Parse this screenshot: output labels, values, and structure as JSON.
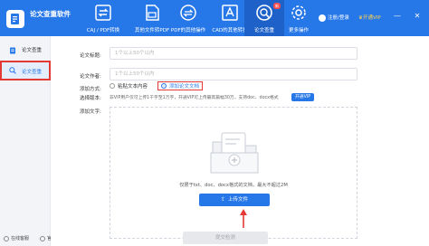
{
  "app": {
    "name": "论文查重软件"
  },
  "toolbar": {
    "items": [
      {
        "label": "CAJ / PDF转换",
        "icon": "convert-file-icon"
      },
      {
        "label": "其他文件转PDF",
        "icon": "file-to-pdf-icon"
      },
      {
        "label": "PDF的其他操作",
        "icon": "pdf-operations-icon"
      },
      {
        "label": "CAD的其他转换",
        "icon": "cad-convert-icon"
      },
      {
        "label": "论文查重",
        "icon": "paper-check-icon",
        "badge": "新"
      },
      {
        "label": "更多操作",
        "icon": "gear-icon"
      }
    ]
  },
  "header": {
    "login": "注册/登录",
    "vip": "开通VIP"
  },
  "sidebar": {
    "items": [
      {
        "label": "论文查重",
        "icon": "document-icon"
      },
      {
        "label": "论文查重",
        "icon": "search-icon"
      }
    ],
    "bottom": [
      {
        "label": "在线客服",
        "icon": "customer-service-icon"
      },
      {
        "label": "官网地址",
        "icon": "globe-icon"
      }
    ]
  },
  "form": {
    "title_label": "论文标题:",
    "title_placeholder": "1个以上50个以内",
    "author_label": "论文作者:",
    "author_placeholder": "1个以上50个以内",
    "method_label": "添加方式:",
    "method_options": [
      "粘贴文本内容",
      "添加论文文档"
    ],
    "selected_method": "添加论文文档",
    "version_label": "选择版本:",
    "version_note": "非VIP用户仅可上传1千字至1万字，开通VIP可上传最高篇幅30万，支持doc、docx格式",
    "vip_button": "开通VIP",
    "add_label": "添加文字:",
    "drop_hint": "仅限于txt、doc、docx格式的文档，最大不超过2M",
    "upload_button": "上传文件",
    "submit_button": "提交检测"
  }
}
